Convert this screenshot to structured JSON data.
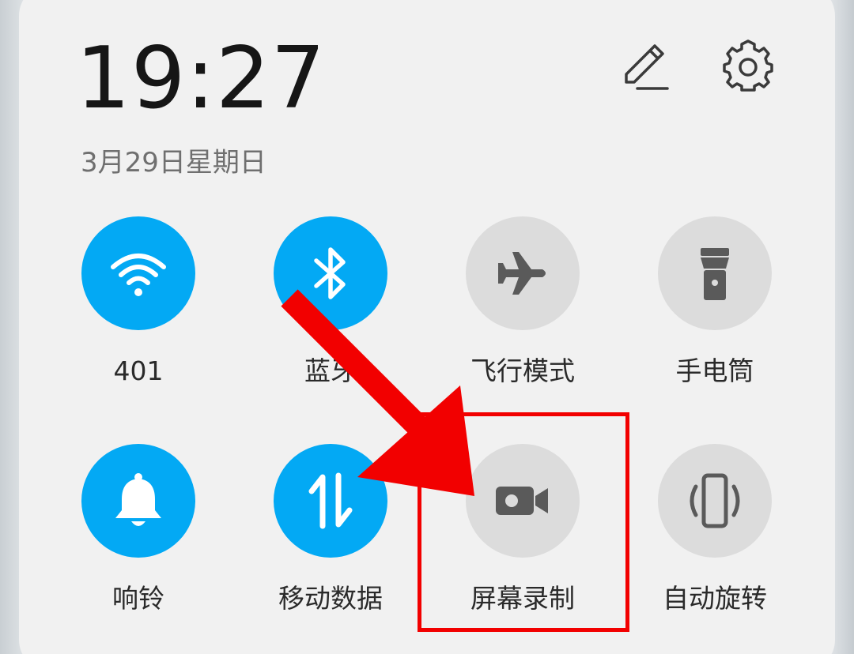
{
  "status": {
    "time": "19:27",
    "date": "3月29日星期日"
  },
  "header_icons": {
    "edit": "pencil-icon",
    "settings": "gear-icon"
  },
  "tiles": [
    {
      "label": "401",
      "icon": "wifi-icon",
      "state": "on"
    },
    {
      "label": "蓝牙",
      "icon": "bluetooth-icon",
      "state": "on"
    },
    {
      "label": "飞行模式",
      "icon": "airplane-icon",
      "state": "off"
    },
    {
      "label": "手电筒",
      "icon": "flashlight-icon",
      "state": "off"
    },
    {
      "label": "响铃",
      "icon": "bell-icon",
      "state": "on"
    },
    {
      "label": "移动数据",
      "icon": "mobile-data-icon",
      "state": "on"
    },
    {
      "label": "屏幕录制",
      "icon": "screen-record-icon",
      "state": "off"
    },
    {
      "label": "自动旋转",
      "icon": "auto-rotate-icon",
      "state": "off"
    }
  ],
  "colors": {
    "active": "#03a9f4",
    "inactive": "#dcdcdc",
    "annotation": "#f20000"
  }
}
